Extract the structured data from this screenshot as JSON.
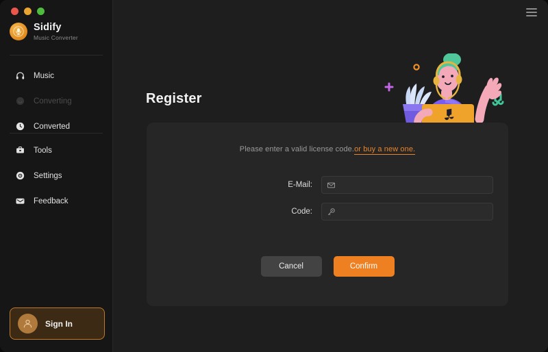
{
  "window": {
    "traffic_lights": [
      {
        "name": "close",
        "color": "#e9564b"
      },
      {
        "name": "minimize",
        "color": "#e9a431"
      },
      {
        "name": "zoom",
        "color": "#4fbb3f"
      }
    ]
  },
  "sidebar": {
    "brand": {
      "logo_icon": "sidify-logo-icon",
      "name": "Sidify",
      "subtitle": "Music Converter"
    },
    "nav_top": [
      {
        "id": "music",
        "label": "Music",
        "icon": "headphones-icon",
        "disabled": false
      },
      {
        "id": "converting",
        "label": "Converting",
        "icon": "converting-icon",
        "disabled": true
      },
      {
        "id": "converted",
        "label": "Converted",
        "icon": "clock-icon",
        "disabled": false
      }
    ],
    "nav_mid": [
      {
        "id": "tools",
        "label": "Tools",
        "icon": "toolbox-icon",
        "disabled": false
      },
      {
        "id": "settings",
        "label": "Settings",
        "icon": "gear-icon",
        "disabled": false
      },
      {
        "id": "feedback",
        "label": "Feedback",
        "icon": "envelope-icon",
        "disabled": false
      }
    ],
    "sign_in": {
      "label": "Sign In",
      "icon": "user-icon",
      "border_color": "#c07b2a",
      "background_color": "#3d2a14"
    }
  },
  "header": {
    "menu_icon": "hamburger-icon"
  },
  "main": {
    "title": "Register",
    "illustration": {
      "name": "person-with-laptop-illustration",
      "colors": {
        "skin": "#f4a9b8",
        "shirt": "#7a5cf0",
        "hair": "#4fc79a",
        "laptop": "#efa32b",
        "plant": "#c8d8f5",
        "pot": "#6f5ae0",
        "sparkle": "#c466e8",
        "note": "#3fc79a",
        "dot": "#ef8f2b"
      }
    },
    "card": {
      "hint_text": "Please enter a valid license code.",
      "hint_link": "or buy a new one.",
      "hint_link_color": "#e8852b",
      "fields": [
        {
          "id": "email",
          "label": "E-Mail:",
          "icon": "envelope-icon",
          "value": "",
          "placeholder": ""
        },
        {
          "id": "code",
          "label": "Code:",
          "icon": "key-icon",
          "value": "",
          "placeholder": ""
        }
      ],
      "buttons": [
        {
          "id": "cancel",
          "label": "Cancel",
          "color": "#434343"
        },
        {
          "id": "confirm",
          "label": "Confirm",
          "color": "#ef8022"
        }
      ]
    }
  }
}
